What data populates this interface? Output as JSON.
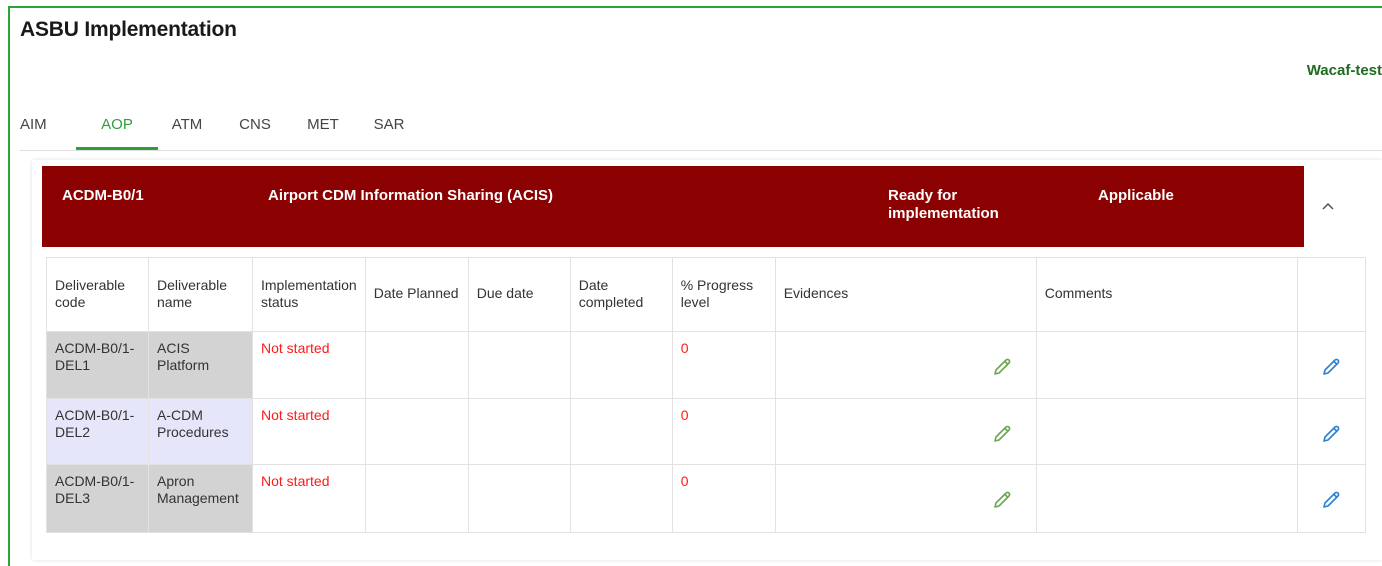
{
  "page": {
    "title": "ASBU Implementation",
    "user": "Wacaf-test"
  },
  "tabs": [
    {
      "label": "AIM",
      "active": false
    },
    {
      "label": "AOP",
      "active": true
    },
    {
      "label": "ATM",
      "active": false
    },
    {
      "label": "CNS",
      "active": false
    },
    {
      "label": "MET",
      "active": false
    },
    {
      "label": "SAR",
      "active": false
    }
  ],
  "element": {
    "code": "ACDM-B0/1",
    "name": "Airport CDM Information Sharing (ACIS)",
    "status": "Ready for implementation",
    "applicability": "Applicable",
    "banner_color": "#8b0000",
    "collapse_icon": "chevron-up-icon"
  },
  "table": {
    "headers": {
      "code": "Deliverable code",
      "name": "Deliverable name",
      "status": "Implementation status",
      "planned": "Date Planned",
      "due": "Due date",
      "completed": "Date completed",
      "progress": "% Progress level",
      "evidences": "Evidences",
      "comments": "Comments"
    },
    "rows": [
      {
        "code": "ACDM-B0/1-DEL1",
        "name": "ACIS Platform",
        "status": "Not started",
        "planned": "",
        "due": "",
        "completed": "",
        "progress": "0",
        "comments": ""
      },
      {
        "code": "ACDM-B0/1-DEL2",
        "name": "A-CDM Procedures",
        "status": "Not started",
        "planned": "",
        "due": "",
        "completed": "",
        "progress": "0",
        "comments": ""
      },
      {
        "code": "ACDM-B0/1-DEL3",
        "name": "Apron Management",
        "status": "Not started",
        "planned": "",
        "due": "",
        "completed": "",
        "progress": "0",
        "comments": ""
      }
    ],
    "evidence_icon": "pencil-icon",
    "edit_icon": "pencil-icon"
  },
  "colors": {
    "accent_green": "#2e9e3c",
    "status_red": "#ff1a1a",
    "evidence_pencil": "#6aa84f",
    "edit_pencil": "#2f80d0"
  }
}
